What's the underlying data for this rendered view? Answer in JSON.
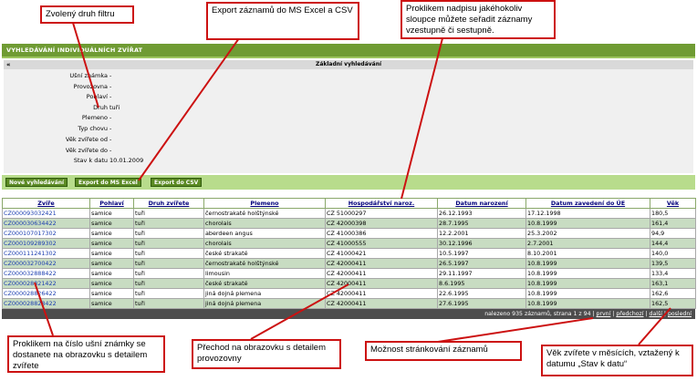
{
  "header": {
    "title": "Vyhledávání individuálních zvířat"
  },
  "search_panel": {
    "toggle": "«",
    "title": "Základní vyhledávání",
    "fields": [
      {
        "label": "Ušní známka",
        "value": "-"
      },
      {
        "label": "Provozovna",
        "value": "-"
      },
      {
        "label": "Pohlaví",
        "value": "-"
      },
      {
        "label": "Druh",
        "value": "tuři"
      },
      {
        "label": "Plemeno",
        "value": "-"
      },
      {
        "label": "Typ chovu",
        "value": "-"
      },
      {
        "label": "Věk zvířete od",
        "value": "-"
      },
      {
        "label": "Věk zvířete do",
        "value": "-"
      },
      {
        "label": "Stav k datu",
        "value": "10.01.2009"
      }
    ]
  },
  "buttons": {
    "new_search": "Nové vyhledávání",
    "export_excel": "Export do MS Excel",
    "export_csv": "Export do CSV"
  },
  "table": {
    "headers": [
      "Zvíře",
      "Pohlaví",
      "Druh zvířete",
      "Plemeno",
      "Hospodářství naroz.",
      "Datum narození",
      "Datum zavedení do ÚE",
      "Věk"
    ],
    "rows": [
      [
        "CZ000093032421",
        "samice",
        "tuři",
        "černostrakaté holštýnské",
        "CZ 51000297",
        "26.12.1993",
        "17.12.1998",
        "180,5"
      ],
      [
        "CZ000030634422",
        "samice",
        "tuři",
        "chorolais",
        "CZ 42000398",
        "28.7.1995",
        "10.8.1999",
        "161,4"
      ],
      [
        "CZ000107017302",
        "samice",
        "tuři",
        "aberdeen angus",
        "CZ 41000386",
        "12.2.2001",
        "25.3.2002",
        "94,9"
      ],
      [
        "CZ000109289302",
        "samice",
        "tuři",
        "chorolais",
        "CZ 41000555",
        "30.12.1996",
        "2.7.2001",
        "144,4"
      ],
      [
        "CZ000111241302",
        "samice",
        "tuři",
        "české strakaté",
        "CZ 41000421",
        "10.5.1997",
        "8.10.2001",
        "140,0"
      ],
      [
        "CZ000032700422",
        "samice",
        "tuři",
        "černostrakaté holštýnské",
        "CZ 42000411",
        "26.5.1997",
        "10.8.1999",
        "139,5"
      ],
      [
        "CZ000032888422",
        "samice",
        "tuři",
        "limousin",
        "CZ 42000411",
        "29.11.1997",
        "10.8.1999",
        "133,4"
      ],
      [
        "CZ000028821422",
        "samice",
        "tuři",
        "české strakaté",
        "CZ 42000411",
        "8.6.1995",
        "10.8.1999",
        "163,1"
      ],
      [
        "CZ000028826422",
        "samice",
        "tuři",
        "jiná dojná plemena",
        "CZ 42000411",
        "22.6.1995",
        "10.8.1999",
        "162,6"
      ],
      [
        "CZ000028828422",
        "samice",
        "tuři",
        "jiná dojná plemena",
        "CZ 42000411",
        "27.6.1995",
        "10.8.1999",
        "162,5"
      ]
    ],
    "footer": {
      "summary": "nalezeno 935 záznamů, strana 1 z 94",
      "first": "první",
      "previous": "předchozí",
      "next": "další",
      "last": "poslední"
    }
  },
  "callouts": {
    "filter": "Zvolený druh filtru",
    "export": "Export záznamů do MS Excel a CSV",
    "sort": "Proklikem nadpisu jakéhokoliv sloupce můžete seřadit záznamy vzestupně či sestupně.",
    "detail_animal": "Proklikem na číslo ušní známky se dostanete na obrazovku s detailem zvířete",
    "detail_farm": "Přechod na obrazovku s detailem provozovny",
    "paging": "Možnost stránkování záznamů",
    "age": "Věk zvířete v měsících, vztažený k datumu „Stav k datu“"
  },
  "colors": {
    "header_green": "#6f9b33",
    "row_alt": "#c8dcc2",
    "callout_border": "#cc1111",
    "link": "#1a3cb0"
  }
}
